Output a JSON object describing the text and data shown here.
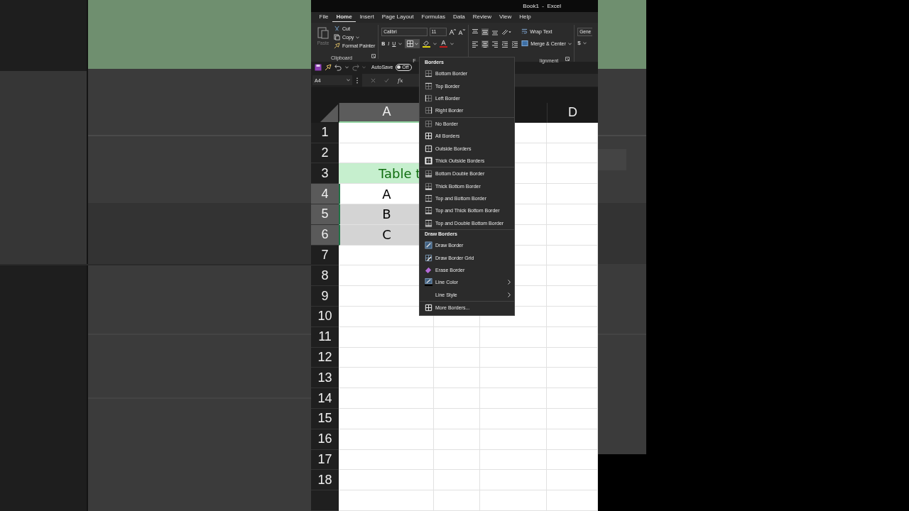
{
  "window": {
    "title": "Book1  -  Excel"
  },
  "tabs": [
    {
      "label": "File",
      "selected": false
    },
    {
      "label": "Home",
      "selected": true
    },
    {
      "label": "Insert",
      "selected": false
    },
    {
      "label": "Page Layout",
      "selected": false
    },
    {
      "label": "Formulas",
      "selected": false
    },
    {
      "label": "Data",
      "selected": false
    },
    {
      "label": "Review",
      "selected": false
    },
    {
      "label": "View",
      "selected": false
    },
    {
      "label": "Help",
      "selected": false
    }
  ],
  "ribbon": {
    "clipboard": {
      "paste": "Paste",
      "paste_disabled": true,
      "cut": "Cut",
      "copy": "Copy",
      "format_painter": "Format Painter",
      "label": "Clipboard"
    },
    "font": {
      "name": "Calibri",
      "size": "11",
      "bold": "B",
      "italic": "I",
      "underline": "U",
      "label": "F"
    },
    "alignment": {
      "wrap_text": "Wrap Text",
      "merge": "Merge & Center",
      "label": "lignment"
    },
    "number": {
      "format": "Gene",
      "currency": "$"
    }
  },
  "quick_access": {
    "autosave": "AutoSave",
    "toggle": "Off",
    "on": false
  },
  "formula_bar": {
    "name_box": "A4",
    "function": "fx"
  },
  "sheet": {
    "columns": [
      {
        "label": "A",
        "selected": true
      },
      {
        "label": "D",
        "selected": false
      }
    ],
    "rows": [
      {
        "number": "1",
        "selected": false,
        "active": false,
        "kind": "empty"
      },
      {
        "number": "2",
        "selected": false,
        "active": false,
        "kind": "empty"
      },
      {
        "number": "3",
        "selected": false,
        "active": false,
        "kind": "title",
        "cell": "Table t"
      },
      {
        "number": "4",
        "selected": true,
        "active": true,
        "kind": "data",
        "cell": "A"
      },
      {
        "number": "5",
        "selected": true,
        "active": false,
        "kind": "data",
        "cell": "B"
      },
      {
        "number": "6",
        "selected": true,
        "active": false,
        "kind": "data",
        "cell": "C"
      },
      {
        "number": "7",
        "selected": false,
        "active": false,
        "kind": "empty"
      },
      {
        "number": "8",
        "selected": false,
        "active": false,
        "kind": "empty"
      },
      {
        "number": "9",
        "selected": false,
        "active": false,
        "kind": "empty"
      },
      {
        "number": "10",
        "selected": false,
        "active": false,
        "kind": "empty"
      },
      {
        "number": "11",
        "selected": false,
        "active": false,
        "kind": "empty"
      },
      {
        "number": "12",
        "selected": false,
        "active": false,
        "kind": "empty"
      },
      {
        "number": "13",
        "selected": false,
        "active": false,
        "kind": "empty"
      },
      {
        "number": "14",
        "selected": false,
        "active": false,
        "kind": "empty"
      },
      {
        "number": "15",
        "selected": false,
        "active": false,
        "kind": "empty"
      },
      {
        "number": "16",
        "selected": false,
        "active": false,
        "kind": "empty"
      },
      {
        "number": "17",
        "selected": false,
        "active": false,
        "kind": "empty"
      },
      {
        "number": "18",
        "selected": false,
        "active": false,
        "kind": "empty"
      }
    ]
  },
  "borders_menu": {
    "groups": [
      {
        "heading": "Borders",
        "items": [
          {
            "label": "Bottom Border",
            "kind": "bottom",
            "submenu": false
          },
          {
            "label": "Top Border",
            "kind": "top",
            "submenu": false
          },
          {
            "label": "Left Border",
            "kind": "left",
            "submenu": false
          },
          {
            "label": "Right Border",
            "kind": "right",
            "submenu": false
          }
        ]
      },
      {
        "items": [
          {
            "label": "No Border",
            "kind": "none",
            "submenu": false
          },
          {
            "label": "All Borders",
            "kind": "all",
            "submenu": false
          },
          {
            "label": "Outside Borders",
            "kind": "outside",
            "submenu": false
          },
          {
            "label": "Thick Outside Borders",
            "kind": "thick_outside",
            "submenu": false
          }
        ]
      },
      {
        "items": [
          {
            "label": "Bottom Double Border",
            "kind": "bottom_double",
            "submenu": false
          },
          {
            "label": "Thick Bottom Border",
            "kind": "thick_bottom",
            "submenu": false
          },
          {
            "label": "Top and Bottom Border",
            "kind": "top_bottom",
            "submenu": false
          },
          {
            "label": "Top and Thick Bottom Border",
            "kind": "top_thick_bottom",
            "submenu": false
          },
          {
            "label": "Top and Double Bottom Border",
            "kind": "top_double_bottom",
            "submenu": false
          }
        ]
      },
      {
        "heading": "Draw Borders",
        "items": [
          {
            "label": "Draw Border",
            "kind": "draw",
            "submenu": false
          },
          {
            "label": "Draw Border Grid",
            "kind": "draw_grid",
            "submenu": false
          },
          {
            "label": "Erase Border",
            "kind": "erase",
            "submenu": false
          },
          {
            "label": "Line Color",
            "kind": "line_color",
            "submenu": true
          },
          {
            "label": "Line Style",
            "kind": "line_style",
            "submenu": true
          }
        ]
      },
      {
        "items": [
          {
            "label": "More Borders...",
            "kind": "more",
            "submenu": false
          }
        ]
      }
    ]
  }
}
